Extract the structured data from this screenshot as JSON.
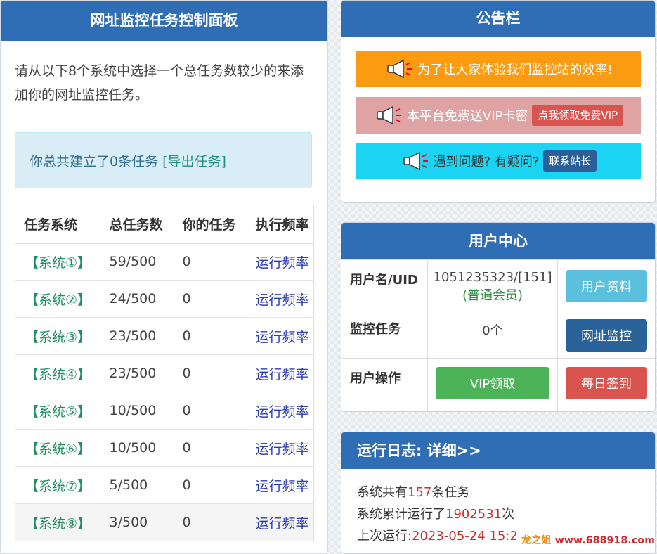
{
  "left": {
    "title": "网址监控任务控制面板",
    "intro": "请从以下8个系统中选择一个总任务数较少的来添加你的网址监控任务。",
    "alert_text": "你总共建立了0条任务",
    "export_link": "[导出任务]",
    "table": {
      "headers": [
        "任务系统",
        "总任务数",
        "你的任务",
        "执行频率"
      ],
      "rows": [
        {
          "system": "【系统①】",
          "total": "59/500",
          "mine": "0",
          "freq": "运行频率"
        },
        {
          "system": "【系统②】",
          "total": "24/500",
          "mine": "0",
          "freq": "运行频率"
        },
        {
          "system": "【系统③】",
          "total": "23/500",
          "mine": "0",
          "freq": "运行频率"
        },
        {
          "system": "【系统④】",
          "total": "23/500",
          "mine": "0",
          "freq": "运行频率"
        },
        {
          "system": "【系统⑤】",
          "total": "10/500",
          "mine": "0",
          "freq": "运行频率"
        },
        {
          "system": "【系统⑥】",
          "total": "10/500",
          "mine": "0",
          "freq": "运行频率"
        },
        {
          "system": "【系统⑦】",
          "total": "5/500",
          "mine": "0",
          "freq": "运行频率"
        },
        {
          "system": "【系统⑧】",
          "total": "3/500",
          "mine": "0",
          "freq": "运行频率"
        }
      ]
    }
  },
  "notice": {
    "title": "公告栏",
    "banner1": "为了让大家体验我们监控站的效率!",
    "banner2": "本平台免费送VIP卡密",
    "banner2_button": "点我领取免费VIP",
    "banner3": "遇到问题? 有疑问?",
    "banner3_button": "联系站长"
  },
  "user_center": {
    "title": "用户中心",
    "username_label": "用户名/UID",
    "uid_value": "1051235323/[151]",
    "member_level": "(普通会员)",
    "profile_button": "用户资料",
    "monitor_label": "监控任务",
    "monitor_count": "0个",
    "monitor_button": "网址监控",
    "ops_label": "用户操作",
    "vip_button": "VIP领取",
    "checkin_button": "每日签到"
  },
  "log": {
    "title": "运行日志: 详细>>",
    "line1_prefix": "系统共有",
    "task_total": "157",
    "line1_suffix": "条任务",
    "line2_prefix": "系统累计运行了",
    "run_total": "1902531",
    "line2_suffix": "次",
    "line3_prefix": "上次运行:",
    "last_run": "2023-05-24 15:2"
  },
  "watermark": {
    "brand": "龙之姐",
    "url": "www.688918.com"
  }
}
